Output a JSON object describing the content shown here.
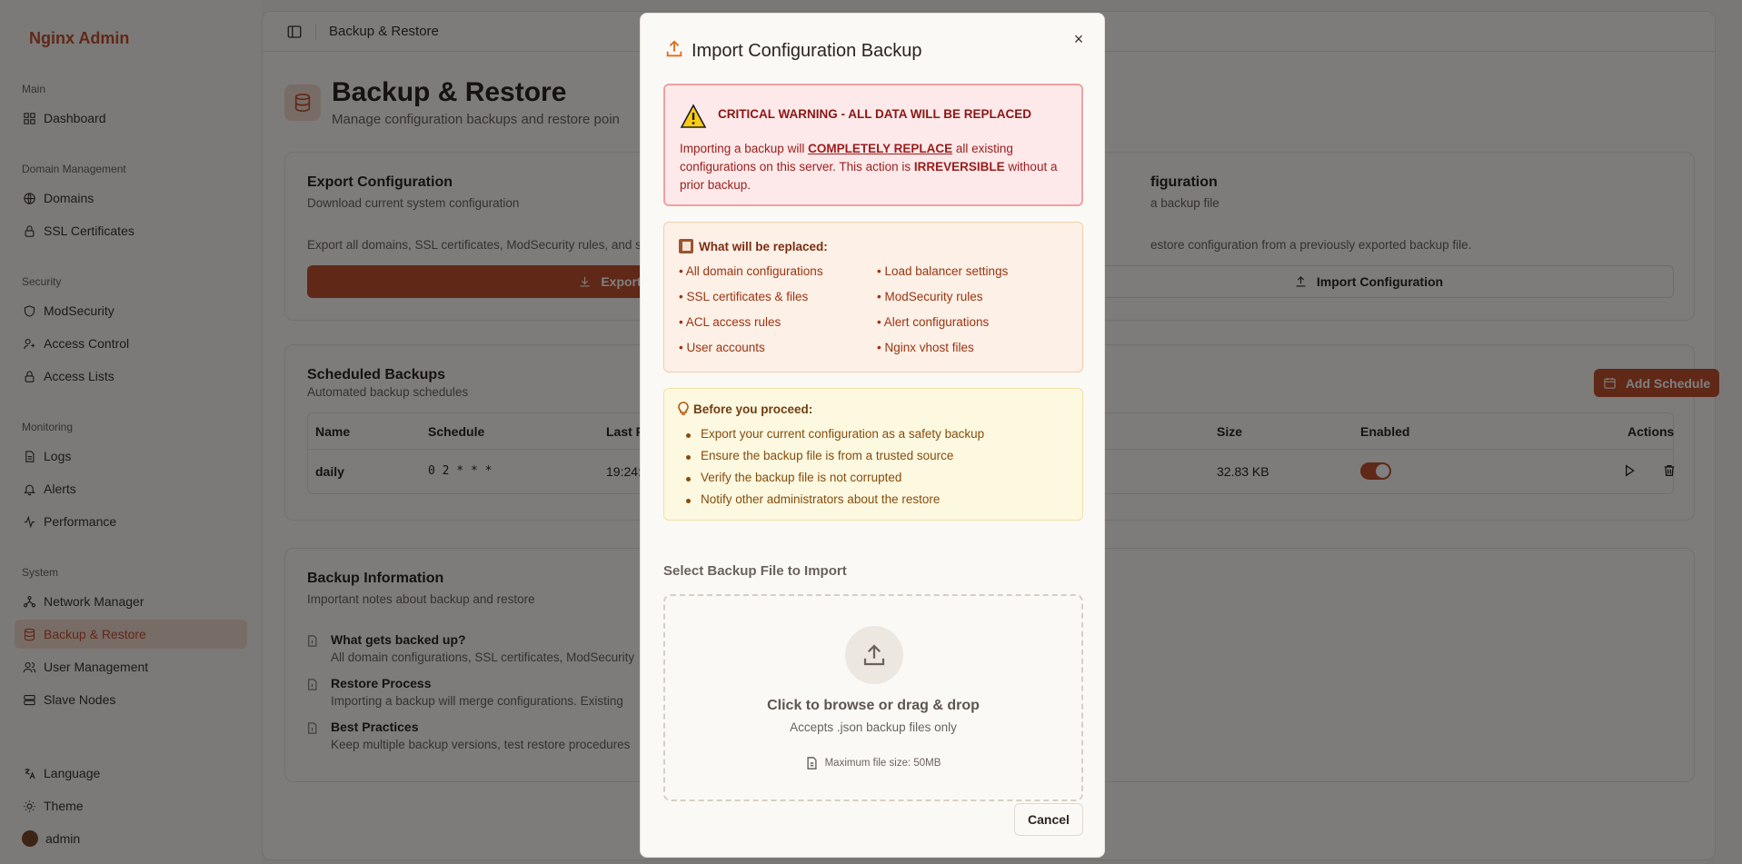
{
  "app": {
    "brand": "Nginx Admin"
  },
  "sidebar": {
    "groups": [
      {
        "label": "Main"
      },
      {
        "label": "Domain Management"
      },
      {
        "label": "Security"
      },
      {
        "label": "Monitoring"
      },
      {
        "label": "System"
      }
    ],
    "items": [
      {
        "label": "Dashboard",
        "icon": "dashboard-icon"
      },
      {
        "label": "Domains",
        "icon": "globe-icon"
      },
      {
        "label": "SSL Certificates",
        "icon": "lock-icon"
      },
      {
        "label": "ModSecurity",
        "icon": "shield-icon"
      },
      {
        "label": "Access Control",
        "icon": "user-key-icon"
      },
      {
        "label": "Access Lists",
        "icon": "lock-icon"
      },
      {
        "label": "Logs",
        "icon": "file-icon"
      },
      {
        "label": "Alerts",
        "icon": "bell-icon"
      },
      {
        "label": "Performance",
        "icon": "activity-icon"
      },
      {
        "label": "Network Manager",
        "icon": "network-icon"
      },
      {
        "label": "Backup & Restore",
        "icon": "database-icon",
        "active": true
      },
      {
        "label": "User Management",
        "icon": "users-icon"
      },
      {
        "label": "Slave Nodes",
        "icon": "server-icon"
      }
    ],
    "footer": [
      {
        "label": "Language",
        "icon": "language-icon"
      },
      {
        "label": "Theme",
        "icon": "sun-icon"
      },
      {
        "label": "admin",
        "icon": "avatar"
      }
    ]
  },
  "topbar": {
    "breadcrumb": "Backup & Restore"
  },
  "page": {
    "title": "Backup & Restore",
    "subtitle": "Manage configuration backups and restore poin"
  },
  "export_card": {
    "title": "Export Configuration",
    "subtitle": "Download current system configuration",
    "body": "Export all domains, SSL certificates, ModSecurity rules, and s",
    "button": "Export C"
  },
  "import_card": {
    "title": "figuration",
    "subtitle": "a backup file",
    "body": "estore configuration from a previously exported backup file.",
    "button": "Import Configuration"
  },
  "schedules": {
    "title": "Scheduled Backups",
    "subtitle": "Automated backup schedules",
    "add_button": "Add Schedule",
    "columns": [
      "Name",
      "Schedule",
      "Last R",
      "Size",
      "Enabled",
      "Actions"
    ],
    "rows": [
      {
        "name": "daily",
        "schedule": "0 2 * * *",
        "last_run": "19:24:",
        "size": "32.83 KB",
        "enabled": true
      }
    ]
  },
  "info": {
    "title": "Backup Information",
    "subtitle": "Important notes about backup and restore",
    "items": [
      {
        "title": "What gets backed up?",
        "desc": "All domain configurations, SSL certificates, ModSecurity"
      },
      {
        "title": "Restore Process",
        "desc": "Importing a backup will merge configurations. Existing"
      },
      {
        "title": "Best Practices",
        "desc": "Keep multiple backup versions, test restore procedures"
      }
    ]
  },
  "modal": {
    "title": "Import Configuration Backup",
    "close": "×",
    "warning": {
      "title": "CRITICAL WARNING - ALL DATA WILL BE REPLACED",
      "text_1": "Importing a backup will ",
      "emph_1": "COMPLETELY REPLACE",
      "text_2": " all existing configurations on this server. This action is ",
      "emph_2": "IRREVERSIBLE",
      "text_3": " without a prior backup."
    },
    "replaced": {
      "title": "What will be replaced:",
      "left": [
        "• All domain configurations",
        "• SSL certificates & files",
        "• ACL access rules",
        "• User accounts"
      ],
      "right": [
        "• Load balancer settings",
        "• ModSecurity rules",
        "• Alert configurations",
        "• Nginx vhost files"
      ]
    },
    "tips": {
      "title": "Before you proceed:",
      "items": [
        "Export your current configuration as a safety backup",
        "Ensure the backup file is from a trusted source",
        "Verify the backup file is not corrupted",
        "Notify other administrators about the restore"
      ]
    },
    "file_select": {
      "label": "Select Backup File to Import",
      "main": "Click to browse or drag & drop",
      "sub": "Accepts .json backup files only",
      "max": "Maximum file size: 50MB"
    },
    "cancel": "Cancel"
  },
  "colors": {
    "accent": "#c0502e",
    "warning_red": "#9b1c1c",
    "orange": "#e36b1f"
  }
}
